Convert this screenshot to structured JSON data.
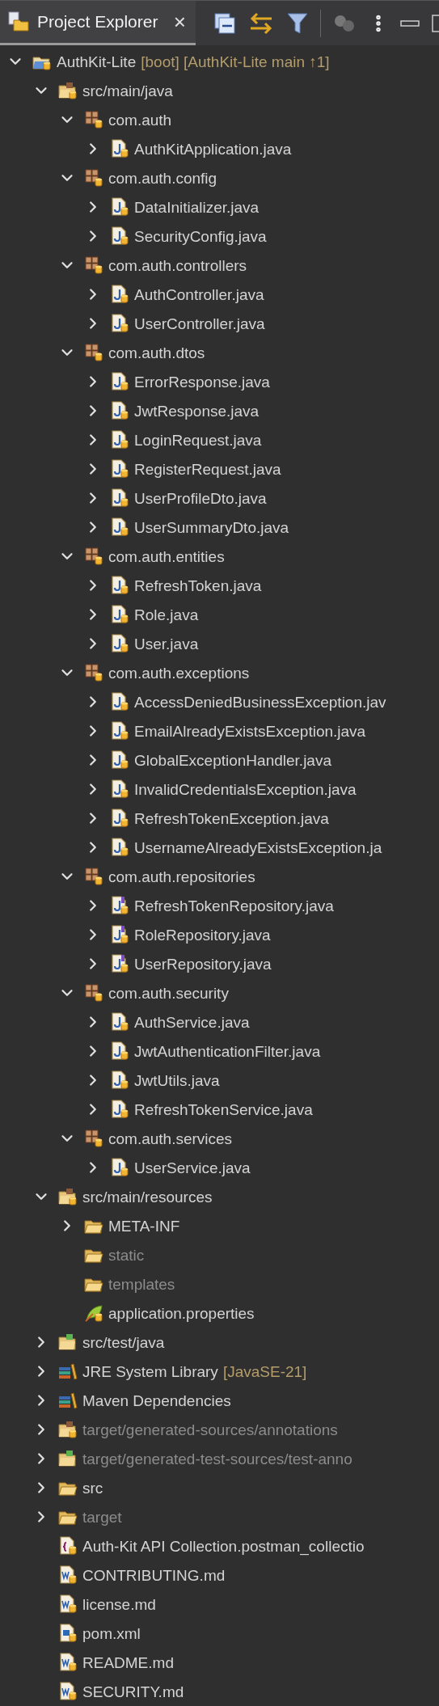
{
  "view_tab": {
    "title": "Project Explorer",
    "selected": true,
    "close": "×"
  },
  "tree": [
    {
      "label": "AuthKit-Lite",
      "decoration": "[boot] [AuthKit-Lite main ↑1]",
      "kind": "project",
      "dimmed": false,
      "expanded": true,
      "children": [
        {
          "label": "src/main/java",
          "kind": "source-folder",
          "dimmed": false,
          "expanded": true,
          "children": [
            {
              "label": "com.auth",
              "kind": "package",
              "dimmed": false,
              "expanded": true,
              "children": [
                {
                  "label": "AuthKitApplication.java",
                  "kind": "class",
                  "dimmed": false,
                  "expanded": false
                }
              ]
            },
            {
              "label": "com.auth.config",
              "kind": "package",
              "dimmed": false,
              "expanded": true,
              "children": [
                {
                  "label": "DataInitializer.java",
                  "kind": "class",
                  "dimmed": false,
                  "expanded": false
                },
                {
                  "label": "SecurityConfig.java",
                  "kind": "class",
                  "dimmed": false,
                  "expanded": false
                }
              ]
            },
            {
              "label": "com.auth.controllers",
              "kind": "package",
              "dimmed": false,
              "expanded": true,
              "children": [
                {
                  "label": "AuthController.java",
                  "kind": "class",
                  "dimmed": false,
                  "expanded": false
                },
                {
                  "label": "UserController.java",
                  "kind": "class",
                  "dimmed": false,
                  "expanded": false
                }
              ]
            },
            {
              "label": "com.auth.dtos",
              "kind": "package",
              "dimmed": false,
              "expanded": true,
              "children": [
                {
                  "label": "ErrorResponse.java",
                  "kind": "class",
                  "dimmed": false,
                  "expanded": false
                },
                {
                  "label": "JwtResponse.java",
                  "kind": "class",
                  "dimmed": false,
                  "expanded": false
                },
                {
                  "label": "LoginRequest.java",
                  "kind": "class",
                  "dimmed": false,
                  "expanded": false
                },
                {
                  "label": "RegisterRequest.java",
                  "kind": "class",
                  "dimmed": false,
                  "expanded": false
                },
                {
                  "label": "UserProfileDto.java",
                  "kind": "class",
                  "dimmed": false,
                  "expanded": false
                },
                {
                  "label": "UserSummaryDto.java",
                  "kind": "class",
                  "dimmed": false,
                  "expanded": false
                }
              ]
            },
            {
              "label": "com.auth.entities",
              "kind": "package",
              "dimmed": false,
              "expanded": true,
              "children": [
                {
                  "label": "RefreshToken.java",
                  "kind": "class",
                  "dimmed": false,
                  "expanded": false
                },
                {
                  "label": "Role.java",
                  "kind": "class",
                  "dimmed": false,
                  "expanded": false
                },
                {
                  "label": "User.java",
                  "kind": "class",
                  "dimmed": false,
                  "expanded": false
                }
              ]
            },
            {
              "label": "com.auth.exceptions",
              "kind": "package",
              "dimmed": false,
              "expanded": true,
              "children": [
                {
                  "label": "AccessDeniedBusinessException.jav",
                  "kind": "class",
                  "dimmed": false,
                  "expanded": false
                },
                {
                  "label": "EmailAlreadyExistsException.java",
                  "kind": "class",
                  "dimmed": false,
                  "expanded": false
                },
                {
                  "label": "GlobalExceptionHandler.java",
                  "kind": "class",
                  "dimmed": false,
                  "expanded": false
                },
                {
                  "label": "InvalidCredentialsException.java",
                  "kind": "class",
                  "dimmed": false,
                  "expanded": false
                },
                {
                  "label": "RefreshTokenException.java",
                  "kind": "class",
                  "dimmed": false,
                  "expanded": false
                },
                {
                  "label": "UsernameAlreadyExistsException.ja",
                  "kind": "class",
                  "dimmed": false,
                  "expanded": false
                }
              ]
            },
            {
              "label": "com.auth.repositories",
              "kind": "package",
              "dimmed": false,
              "expanded": true,
              "children": [
                {
                  "label": "RefreshTokenRepository.java",
                  "kind": "interface",
                  "dimmed": false,
                  "expanded": false
                },
                {
                  "label": "RoleRepository.java",
                  "kind": "interface",
                  "dimmed": false,
                  "expanded": false
                },
                {
                  "label": "UserRepository.java",
                  "kind": "interface",
                  "dimmed": false,
                  "expanded": false
                }
              ]
            },
            {
              "label": "com.auth.security",
              "kind": "package",
              "dimmed": false,
              "expanded": true,
              "children": [
                {
                  "label": "AuthService.java",
                  "kind": "class",
                  "dimmed": false,
                  "expanded": false
                },
                {
                  "label": "JwtAuthenticationFilter.java",
                  "kind": "class",
                  "dimmed": false,
                  "expanded": false
                },
                {
                  "label": "JwtUtils.java",
                  "kind": "class",
                  "dimmed": false,
                  "expanded": false
                },
                {
                  "label": "RefreshTokenService.java",
                  "kind": "class",
                  "dimmed": false,
                  "expanded": false
                }
              ]
            },
            {
              "label": "com.auth.services",
              "kind": "package",
              "dimmed": false,
              "expanded": true,
              "children": [
                {
                  "label": "UserService.java",
                  "kind": "class",
                  "dimmed": false,
                  "expanded": false
                }
              ]
            }
          ]
        },
        {
          "label": "src/main/resources",
          "kind": "source-folder",
          "dimmed": false,
          "expanded": true,
          "children": [
            {
              "label": "META-INF",
              "kind": "folder",
              "dimmed": false,
              "expanded": false
            },
            {
              "label": "static",
              "kind": "folder",
              "dimmed": true
            },
            {
              "label": "templates",
              "kind": "folder",
              "dimmed": true
            },
            {
              "label": "application.properties",
              "kind": "properties",
              "dimmed": false
            }
          ]
        },
        {
          "label": "src/test/java",
          "kind": "test-folder",
          "dimmed": false,
          "expanded": false
        },
        {
          "label": "JRE System Library",
          "decoration": "[JavaSE-21]",
          "kind": "library",
          "dimmed": false,
          "expanded": false
        },
        {
          "label": "Maven Dependencies",
          "kind": "library",
          "dimmed": false,
          "expanded": false
        },
        {
          "label": "target/generated-sources/annotations",
          "kind": "source-folder",
          "dimmed": true,
          "expanded": false
        },
        {
          "label": "target/generated-test-sources/test-anno",
          "kind": "test-folder",
          "dimmed": true,
          "expanded": false
        },
        {
          "label": "src",
          "kind": "folder",
          "dimmed": false,
          "expanded": false
        },
        {
          "label": "target",
          "kind": "folder",
          "dimmed": true,
          "expanded": false
        },
        {
          "label": "Auth-Kit API Collection.postman_collectio",
          "kind": "json",
          "dimmed": false
        },
        {
          "label": "CONTRIBUTING.md",
          "kind": "markdown",
          "dimmed": false
        },
        {
          "label": "license.md",
          "kind": "markdown",
          "dimmed": false
        },
        {
          "label": "pom.xml",
          "kind": "xml",
          "dimmed": false
        },
        {
          "label": "README.md",
          "kind": "markdown",
          "dimmed": false
        },
        {
          "label": "SECURITY.md",
          "kind": "markdown",
          "dimmed": false
        }
      ]
    }
  ]
}
